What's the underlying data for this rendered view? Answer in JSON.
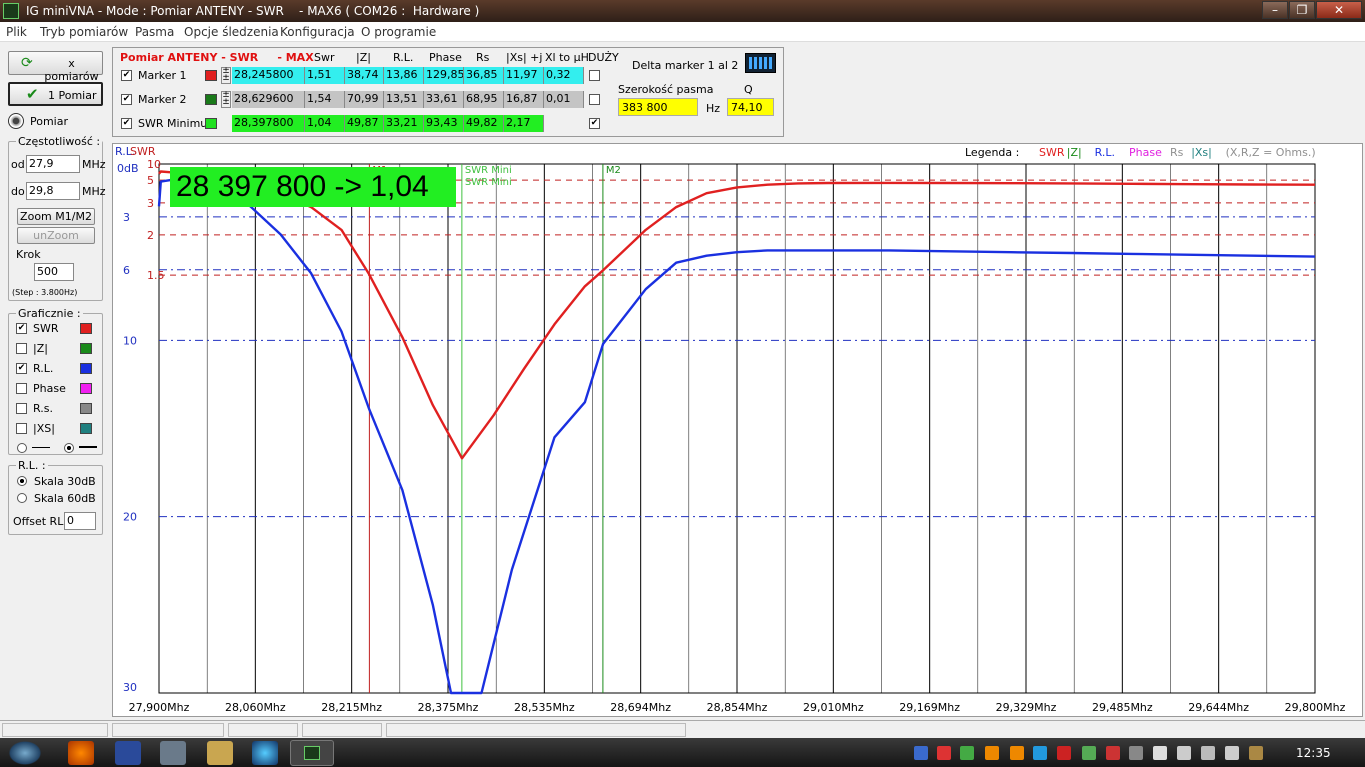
{
  "window": {
    "title": "IG miniVNA - Mode : Pomiar ANTENY - SWR    - MAX6 ( COM26 :  Hardware )",
    "min": "–",
    "max": "❐",
    "close": "✕"
  },
  "menu": [
    "Plik",
    "Tryb pomiarów",
    "Pasma",
    "Opcje śledzenia",
    "Konfiguracja",
    "O programie"
  ],
  "left": {
    "x_pomiarow": "x pomiarów",
    "one_pomiar": "1 Pomiar",
    "pomiar": "Pomiar",
    "freq_title": "Częstotliwość :",
    "od_label": "od",
    "od_value": "27,9",
    "do_label": "do",
    "do_value": "29,8",
    "unit": "MHz",
    "zoom": "Zoom M1/M2",
    "unzoom": "unZoom",
    "krok_label": "Krok",
    "krok_value": "500",
    "step": "(Step : 3.800Hz)",
    "graf_title": "Graficznie :",
    "graf": [
      {
        "label": "SWR",
        "checked": true,
        "color": "#e02020"
      },
      {
        "label": "|Z|",
        "checked": false,
        "color": "#1a8a1a"
      },
      {
        "label": "R.L.",
        "checked": true,
        "color": "#1a30e0"
      },
      {
        "label": "Phase",
        "checked": false,
        "color": "#f020f0"
      },
      {
        "label": "R.s.",
        "checked": false,
        "color": "#888888"
      },
      {
        "label": "|XS|",
        "checked": false,
        "color": "#208080"
      }
    ],
    "rl_title": "R.L. :",
    "skala30": "Skala 30dB",
    "skala60": "Skala 60dB",
    "offset_label": "Offset RL",
    "offset_value": "0"
  },
  "markers": {
    "title": "Pomiar ANTENY - SWR     - MAX",
    "headers": [
      "Swr",
      "|Z|",
      "R.L.",
      "Phase",
      "Rs",
      "|Xs| +j",
      "Xl to µH",
      "DUŻY"
    ],
    "rows": [
      {
        "label": "Marker 1",
        "checked": true,
        "color": "#e02020",
        "values": [
          "28,245800",
          "1,51",
          "38,74",
          "13,86",
          "129,85",
          "36,85",
          "11,97",
          "0,32"
        ],
        "duzy": false
      },
      {
        "label": "Marker 2",
        "checked": true,
        "color": "#1a7a1a",
        "values": [
          "28,629600",
          "1,54",
          "70,99",
          "13,51",
          "33,61",
          "68,95",
          "16,87",
          "0,01"
        ],
        "duzy": false
      },
      {
        "label": "SWR Minimu",
        "checked": true,
        "color": "#20e020",
        "values": [
          "28,397800",
          "1,04",
          "49,87",
          "33,21",
          "93,43",
          "49,82",
          "2,17"
        ],
        "duzy": true
      }
    ],
    "delta": "Delta marker 1 al 2",
    "szer_label": "Szerokość pasma",
    "szer_value": "383 800",
    "hz": "Hz",
    "q_label": "Q",
    "q_value": "74,10"
  },
  "chart_data": {
    "type": "line",
    "big_readout": "28 397 800 -> 1,04",
    "legend_label": "Legenda :",
    "legend": [
      {
        "name": "SWR",
        "color": "#e02020"
      },
      {
        "name": "|Z|",
        "color": "#1a8a1a"
      },
      {
        "name": "R.L.",
        "color": "#1a30e0"
      },
      {
        "name": "Phase",
        "color": "#e020e0"
      },
      {
        "name": "Rs",
        "color": "#909090"
      },
      {
        "name": "|Xs|",
        "color": "#208080"
      },
      {
        "name": "(X,R,Z = Ohms.)",
        "color": "#909090"
      }
    ],
    "left_header": [
      "R.L.",
      "SWR"
    ],
    "rl_ticks": [
      "0dB",
      "3",
      "6",
      "10",
      "20",
      "30"
    ],
    "swr_ticks": [
      "10",
      "5",
      "3",
      "2",
      "1.5",
      "1"
    ],
    "x_ticks": [
      "27,900Mhz",
      "28,060Mhz",
      "28,215Mhz",
      "28,375Mhz",
      "28,535Mhz",
      "28,694Mhz",
      "28,854Mhz",
      "29,010Mhz",
      "29,169Mhz",
      "29,329Mhz",
      "29,485Mhz",
      "29,644Mhz",
      "29,800Mhz"
    ],
    "xlim": [
      27.9,
      29.8
    ],
    "markers": [
      {
        "label": "M1",
        "freq": 28.2458
      },
      {
        "label": "SWR\nMini",
        "freq": 28.3978
      },
      {
        "label": "M2",
        "freq": 28.6296
      }
    ],
    "series": [
      {
        "name": "SWR",
        "color": "#e02020",
        "x": [
          27.9,
          27.903,
          27.92,
          27.95,
          28.0,
          28.05,
          28.1,
          28.15,
          28.2,
          28.245,
          28.3,
          28.35,
          28.398,
          28.45,
          28.5,
          28.55,
          28.6,
          28.63,
          28.7,
          28.75,
          28.8,
          28.85,
          28.9,
          28.95,
          29.0,
          29.1,
          29.2,
          29.3,
          29.4,
          29.5,
          29.6,
          29.7,
          29.8
        ],
        "y": [
          6.2,
          6.8,
          6.6,
          6.2,
          5.4,
          4.5,
          3.6,
          2.8,
          2.1,
          1.51,
          1.2,
          1.08,
          1.04,
          1.07,
          1.13,
          1.24,
          1.42,
          1.54,
          2.1,
          2.8,
          3.6,
          4.1,
          4.4,
          4.55,
          4.6,
          4.62,
          4.6,
          4.58,
          4.55,
          4.5,
          4.45,
          4.42,
          4.4
        ]
      },
      {
        "name": "R.L.",
        "color": "#1a30e0",
        "x": [
          27.9,
          27.903,
          27.92,
          27.97,
          28.0,
          28.05,
          28.1,
          28.15,
          28.2,
          28.245,
          28.3,
          28.35,
          28.38,
          28.398,
          28.43,
          28.48,
          28.55,
          28.6,
          28.63,
          28.7,
          28.75,
          28.8,
          28.85,
          28.9,
          29.0,
          29.1,
          29.2,
          29.3,
          29.4,
          29.5,
          29.6,
          29.7,
          29.8
        ],
        "y": [
          2.4,
          1.0,
          0.9,
          1.1,
          1.5,
          2.4,
          4.0,
          6.2,
          9.5,
          13.86,
          18.5,
          25,
          32,
          34,
          31,
          23,
          15.5,
          13.51,
          10.2,
          7.1,
          5.6,
          5.2,
          5.0,
          4.9,
          4.9,
          4.9,
          4.95,
          5.0,
          5.05,
          5.1,
          5.15,
          5.2,
          5.25
        ]
      }
    ]
  },
  "taskbar": {
    "time": "12:35"
  }
}
